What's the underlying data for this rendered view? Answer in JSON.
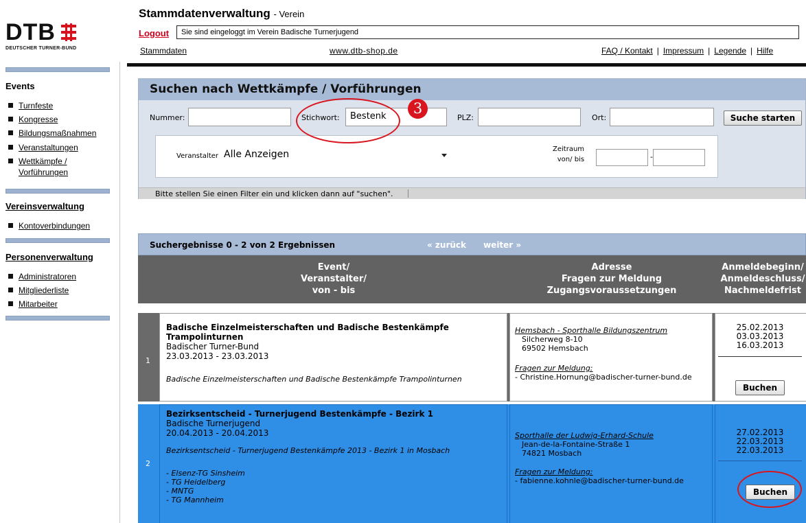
{
  "logo": {
    "text": "DTB",
    "subtitle": "DEUTSCHER TURNER-BUND",
    "mark_color": "#d8121d"
  },
  "header": {
    "title": "Stammdatenverwaltung",
    "title_suffix": "- Verein",
    "logout": "Logout",
    "login_info": "Sie sind eingeloggt im Verein Badische Turnerjugend",
    "links": {
      "stammdaten": "Stammdaten",
      "shop": "www.dtb-shop.de",
      "faq": "FAQ / Kontakt",
      "impressum": "Impressum",
      "legende": "Legende",
      "hilfe": "Hilfe",
      "separator": "|"
    }
  },
  "sidebar": {
    "events_heading": "Events",
    "events": [
      "Turnfeste",
      "Kongresse",
      "Bildungsmaßnahmen",
      "Veranstaltungen",
      "Wettkämpfe /",
      "Vorführungen"
    ],
    "verein_heading": "Vereinsverwaltung",
    "verein_items": [
      "Kontoverbindungen"
    ],
    "personen_heading": "Personenverwaltung",
    "personen_items": [
      "Administratoren",
      "Mitgliederliste",
      "Mitarbeiter"
    ]
  },
  "search": {
    "title": "Suchen nach Wettkämpfe / Vorführungen",
    "nummer_label": "Nummer:",
    "nummer_value": "",
    "stichwort_label": "Stichwort:",
    "stichwort_value": "Bestenk",
    "plz_label": "PLZ:",
    "plz_value": "",
    "ort_label": "Ort:",
    "ort_value": "",
    "button": "Suche starten",
    "veranstalter_label": "Veranstalter",
    "veranstalter_value": "Alle Anzeigen",
    "zeitraum_label_1": "Zeitraum",
    "zeitraum_label_2": "von/ bis",
    "zeitraum_dash": "-",
    "status": "Bitte stellen Sie einen Filter ein und klicken dann auf \"suchen\".",
    "step_badge": "3",
    "annotation_color": "#d9161f"
  },
  "results": {
    "summary": "Suchergebnisse 0 - 2 von 2 Ergebnissen",
    "prev": "« zurück",
    "next": "weiter »",
    "columns": {
      "event": [
        "Event/",
        "Veranstalter/",
        "von - bis"
      ],
      "adresse": [
        "Adresse",
        "Fragen zur Meldung",
        "Zugangsvoraussetzungen"
      ],
      "anmeldung": [
        "Anmeldebeginn/",
        "Anmeldeschluss/",
        "Nachmeldefrist"
      ]
    },
    "rows": [
      {
        "index": "1",
        "title_1": "Badische Einzelmeisterschaften und Badische Bestenkämpfe",
        "title_2": "Trampolinturnen",
        "organizer": "Badischer Turner-Bund",
        "dates": "23.03.2013 - 23.03.2013",
        "description": "Badische Einzelmeisterschaften und Badische Bestenkämpfe Trampolinturnen",
        "venue": "Hemsbach - Sporthalle Bildungszentrum",
        "street": "Silcherweg 8-10",
        "city": "69502 Hemsbach",
        "fragen_label": "Fragen zur Meldung:",
        "contact": "- Christine.Hornung@badischer-turner-bund.de",
        "anmeldebeginn": "25.02.2013",
        "anmeldeschluss": "03.03.2013",
        "nachmeldefrist": "16.03.2013",
        "button": "Buchen"
      },
      {
        "index": "2",
        "title_1": "Bezirksentscheid - Turnerjugend Bestenkämpfe - Bezirk 1",
        "organizer": "Badische Turnerjugend",
        "dates": "20.04.2013 - 20.04.2013",
        "description": "Bezirksentscheid - Turnerjugend Bestenkämpfe 2013 - Bezirk 1 in Mosbach",
        "participants": [
          "- Elsenz-TG Sinsheim",
          "- TG Heidelberg",
          "- MNTG",
          "- TG Mannheim"
        ],
        "venue": "Sporthalle der Ludwig-Erhard-Schule",
        "street": "Jean-de-la-Fontaine-Straße 1",
        "city": "74821 Mosbach",
        "fragen_label": "Fragen zur Meldung:",
        "contact": "- fabienne.kohnle@badischer-turner-bund.de",
        "anmeldebeginn": "27.02.2013",
        "anmeldeschluss": "22.03.2013",
        "nachmeldefrist": "22.03.2013",
        "button": "Buchen"
      }
    ]
  }
}
